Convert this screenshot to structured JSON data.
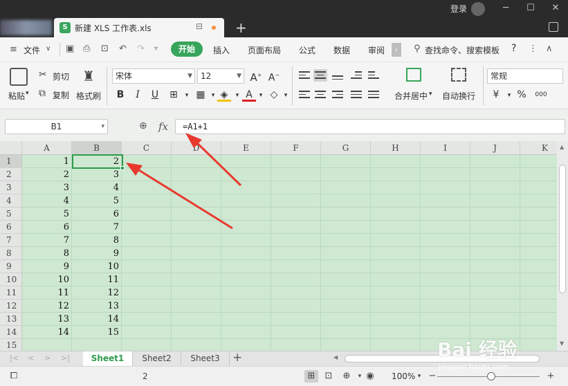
{
  "titlebar": {
    "login": "登录",
    "window_controls": [
      "minimize-icon",
      "restore-icon",
      "close-icon"
    ]
  },
  "tab": {
    "file_name": "新建 XLS 工作表.xls",
    "app_icon": "S"
  },
  "menu": {
    "file": "文件",
    "home": "开始",
    "insert": "插入",
    "layout": "页面布局",
    "formula": "公式",
    "data": "数据",
    "review": "审阅",
    "search": "查找命令、搜索模板",
    "help": "?"
  },
  "ribbon": {
    "paste": "粘贴",
    "cut": "剪切",
    "copy": "复制",
    "format_painter": "格式刷",
    "font_name": "宋体",
    "font_size": "12",
    "merge_center": "合并居中",
    "wrap_text": "自动换行",
    "number_format": "常规",
    "bold": "B",
    "italic": "I",
    "underline": "U",
    "percent": "%",
    "thousands": "000",
    "grow_font": "A",
    "shrink_font": "A"
  },
  "formula_bar": {
    "name_box": "B1",
    "fx_label": "fx",
    "formula": "=A1+1"
  },
  "sheet": {
    "columns": [
      "A",
      "B",
      "C",
      "D",
      "E",
      "F",
      "G",
      "H",
      "I",
      "J",
      "K"
    ],
    "rows": [
      "1",
      "2",
      "3",
      "4",
      "5",
      "6",
      "7",
      "8",
      "9",
      "10",
      "11",
      "12",
      "13",
      "14",
      "15"
    ],
    "col_a": [
      "1",
      "2",
      "3",
      "4",
      "5",
      "6",
      "7",
      "8",
      "9",
      "10",
      "11",
      "12",
      "13",
      "14"
    ],
    "col_b": [
      "2",
      "3",
      "4",
      "5",
      "6",
      "7",
      "8",
      "9",
      "10",
      "11",
      "12",
      "13",
      "14",
      "15"
    ],
    "selected_cell": "B1"
  },
  "sheet_tabs": [
    "Sheet1",
    "Sheet2",
    "Sheet3"
  ],
  "statusbar": {
    "value": "2",
    "zoom": "100%",
    "zoom_level_percent": 100
  },
  "watermark": {
    "brand": "Bai 经验",
    "url": "jingyan.baidu.com"
  },
  "colors": {
    "accent_green": "#37a55b",
    "grid_bg": "#cfe8d1",
    "annotation_red": "#e8392f"
  }
}
